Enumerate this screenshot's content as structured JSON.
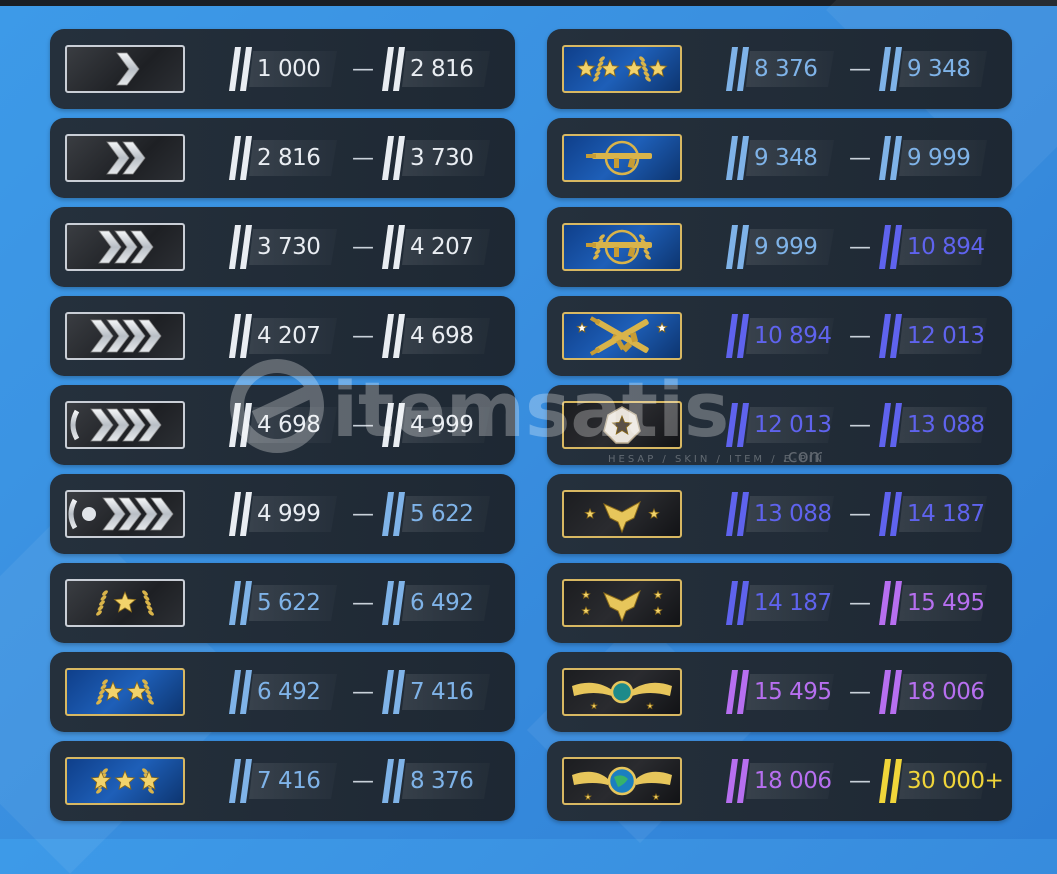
{
  "colors": {
    "white": "#e9edf2",
    "light_blue": "#7fb3e8",
    "blue": "#6a8ff0",
    "indigo": "#5f63ee",
    "purple": "#b76ff0",
    "yellow": "#f0d53a"
  },
  "separator": "—",
  "ranks": [
    {
      "name": "silver-1",
      "icon": "chevron-1-icon",
      "min": "1 000",
      "max": "2 816",
      "min_color": "white",
      "max_color": "white"
    },
    {
      "name": "silver-2",
      "icon": "chevron-2-icon",
      "min": "2 816",
      "max": "3 730",
      "min_color": "white",
      "max_color": "white"
    },
    {
      "name": "silver-3",
      "icon": "chevron-3-icon",
      "min": "3 730",
      "max": "4 207",
      "min_color": "white",
      "max_color": "white"
    },
    {
      "name": "silver-4",
      "icon": "chevron-4-icon",
      "min": "4 207",
      "max": "4 698",
      "min_color": "white",
      "max_color": "white"
    },
    {
      "name": "silver-elite",
      "icon": "chevron-elite-icon",
      "min": "4 698",
      "max": "4 999",
      "min_color": "white",
      "max_color": "white"
    },
    {
      "name": "silver-elite-master",
      "icon": "chevron-elite-master-icon",
      "min": "4 999",
      "max": "5 622",
      "min_color": "white",
      "max_color": "light_blue"
    },
    {
      "name": "gold-nova-1",
      "icon": "gold-star-1-icon",
      "min": "5 622",
      "max": "6 492",
      "min_color": "light_blue",
      "max_color": "light_blue"
    },
    {
      "name": "gold-nova-2",
      "icon": "gold-star-2-icon",
      "min": "6 492",
      "max": "7 416",
      "min_color": "light_blue",
      "max_color": "light_blue"
    },
    {
      "name": "gold-nova-3",
      "icon": "gold-star-3-icon",
      "min": "7 416",
      "max": "8 376",
      "min_color": "light_blue",
      "max_color": "light_blue"
    },
    {
      "name": "gold-nova-master",
      "icon": "gold-star-4-icon",
      "min": "8 376",
      "max": "9 348",
      "min_color": "light_blue",
      "max_color": "light_blue"
    },
    {
      "name": "master-guardian-1",
      "icon": "ak-rifle-icon",
      "min": "9 348",
      "max": "9 999",
      "min_color": "light_blue",
      "max_color": "light_blue"
    },
    {
      "name": "master-guardian-2",
      "icon": "ak-rifle-wreath-icon",
      "min": "9 999",
      "max": "10 894",
      "min_color": "light_blue",
      "max_color": "indigo"
    },
    {
      "name": "master-guardian-elite",
      "icon": "crossed-rifles-icon",
      "min": "10 894",
      "max": "12 013",
      "min_color": "indigo",
      "max_color": "indigo"
    },
    {
      "name": "distinguished-master-guardian",
      "icon": "star-emblem-icon",
      "min": "12 013",
      "max": "13 088",
      "min_color": "indigo",
      "max_color": "indigo"
    },
    {
      "name": "legendary-eagle",
      "icon": "eagle-icon",
      "min": "13 088",
      "max": "14 187",
      "min_color": "indigo",
      "max_color": "indigo"
    },
    {
      "name": "legendary-eagle-master",
      "icon": "eagle-stars-icon",
      "min": "14 187",
      "max": "15 495",
      "min_color": "indigo",
      "max_color": "purple"
    },
    {
      "name": "supreme-master-first-class",
      "icon": "winged-emblem-icon",
      "min": "15 495",
      "max": "18 006",
      "min_color": "purple",
      "max_color": "purple"
    },
    {
      "name": "global-elite",
      "icon": "globe-emblem-icon",
      "min": "18 006",
      "max": "30 000+",
      "min_color": "purple",
      "max_color": "yellow"
    }
  ],
  "watermark": {
    "brand": "itemsatis",
    "tagline": "HESAP / SKIN / ITEM / E-PIN",
    "suffix": ".com"
  }
}
